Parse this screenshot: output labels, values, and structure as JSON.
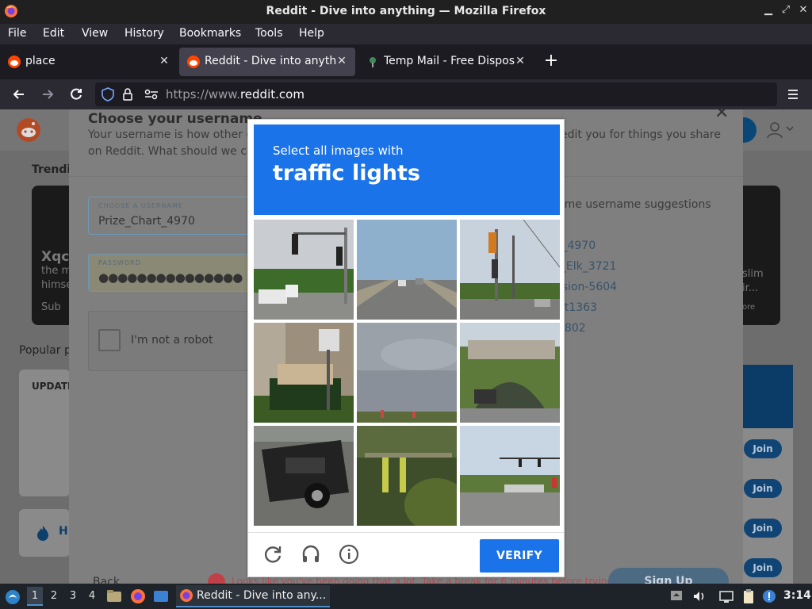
{
  "window": {
    "title": "Reddit - Dive into anything — Mozilla Firefox"
  },
  "menu": [
    "File",
    "Edit",
    "View",
    "History",
    "Bookmarks",
    "Tools",
    "Help"
  ],
  "tabs": [
    {
      "label": "place",
      "active": false
    },
    {
      "label": "Reddit - Dive into anythin",
      "active": true
    },
    {
      "label": "Temp Mail - Free Disposa",
      "active": false
    }
  ],
  "url": {
    "prefix": "https://www.",
    "domain": "reddit.com"
  },
  "reddit": {
    "trending": "Trendin",
    "card_left_title": "Xqc",
    "card_left_line1": "the m",
    "card_left_line2": "himse",
    "card_left_sub": "Sub",
    "card_right_1": "slim",
    "card_right_2": "ir...",
    "card_right_3": "ore",
    "popular": "Popular po",
    "update": "UPDATE",
    "home": "H",
    "join_label": "Join"
  },
  "modal": {
    "title": "Choose your username",
    "desc_line1_left": "Your username is how other co",
    "desc_line1_right": "edit you for things you share",
    "desc_line2": "on Reddit. What should we call",
    "username_label": "CHOOSE A USERNAME",
    "username_value": "Prize_Chart_4970",
    "password_label": "PASSWORD",
    "password_value": "●●●●●●●●●●●●●●●",
    "not_robot": "I'm not a robot",
    "suggestions_title": "ome username suggestions",
    "suggestions": [
      "t_4970",
      "l_Elk_3721",
      "rsion-5604",
      "nt1363",
      "2802"
    ],
    "back": "Back",
    "warning": "Looks like you've been doing that a lot. Take a break for 6 minutes before trying again.",
    "signup": "Sign Up"
  },
  "captcha": {
    "instruction": "Select all images with",
    "target": "traffic lights",
    "verify": "VERIFY"
  },
  "taskbar": {
    "workspaces": [
      "1",
      "2",
      "3",
      "4"
    ],
    "active_workspace": "1",
    "task_title": "Reddit - Dive into any...",
    "clock": "3:14"
  },
  "colors": {
    "accent": "#1a73e8",
    "firefox_dark": "#2b2a33",
    "reddit_orange": "#ff4500"
  }
}
